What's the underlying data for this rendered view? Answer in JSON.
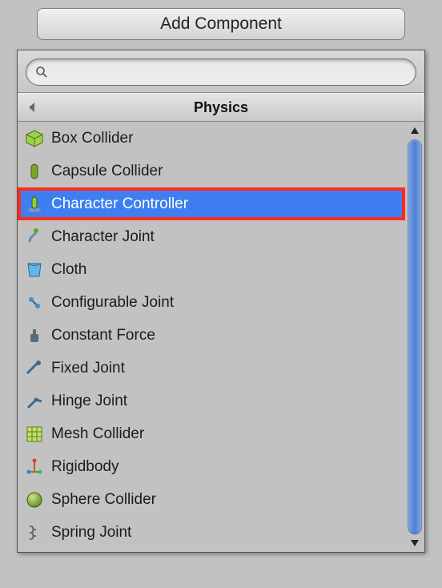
{
  "button": {
    "label": "Add Component"
  },
  "search": {
    "placeholder": "",
    "value": ""
  },
  "header": {
    "title": "Physics"
  },
  "selected_index": 2,
  "items": [
    {
      "label": "Box Collider",
      "icon": "box-collider-icon"
    },
    {
      "label": "Capsule Collider",
      "icon": "capsule-collider-icon"
    },
    {
      "label": "Character Controller",
      "icon": "character-controller-icon"
    },
    {
      "label": "Character Joint",
      "icon": "character-joint-icon"
    },
    {
      "label": "Cloth",
      "icon": "cloth-icon"
    },
    {
      "label": "Configurable Joint",
      "icon": "configurable-joint-icon"
    },
    {
      "label": "Constant Force",
      "icon": "constant-force-icon"
    },
    {
      "label": "Fixed Joint",
      "icon": "fixed-joint-icon"
    },
    {
      "label": "Hinge Joint",
      "icon": "hinge-joint-icon"
    },
    {
      "label": "Mesh Collider",
      "icon": "mesh-collider-icon"
    },
    {
      "label": "Rigidbody",
      "icon": "rigidbody-icon"
    },
    {
      "label": "Sphere Collider",
      "icon": "sphere-collider-icon"
    },
    {
      "label": "Spring Joint",
      "icon": "spring-joint-icon"
    }
  ],
  "icon_svg": {
    "box-collider-icon": "<svg width='24' height='24' viewBox='0 0 24 24'><polygon points='12,2 22,7 22,17 12,22 2,17 2,7' fill='#9fd24a' stroke='#4b6e16' stroke-width='1'/><polyline points='2,7 12,12 22,7' fill='none' stroke='#4b6e16' stroke-width='1'/><line x1='12' y1='12' x2='12' y2='22' stroke='#4b6e16' stroke-width='1'/></svg>",
    "capsule-collider-icon": "<svg width='24' height='24' viewBox='0 0 24 24'><rect x='8' y='3' width='8' height='18' rx='4' fill='#7aa52a' stroke='#3d5a12' stroke-width='1'/></svg>",
    "character-controller-icon": "<svg width='24' height='24' viewBox='0 0 24 24'><ellipse cx='12' cy='19' rx='8' ry='3' fill='#8aa0b5' opacity='0.7'/><rect x='9' y='3' width='6' height='14' rx='3' fill='#8fcf3c' stroke='#3d5a12' stroke-width='1'/></svg>",
    "character-joint-icon": "<svg width='24' height='24' viewBox='0 0 24 24'><path d='M6 18 C6 10, 14 10, 14 4' fill='none' stroke='#5b8fb9' stroke-width='3'/><circle cx='14' cy='4' r='3' fill='#6e9e2b'/></svg>",
    "cloth-icon": "<svg width='24' height='24' viewBox='0 0 24 24'><path d='M4 4 L20 4 L18 20 L6 20 Z' fill='#61b8e6' stroke='#2a6a94' stroke-width='1'/><path d='M4 4 Q12 9 20 4' fill='none' stroke='#2a6a94' stroke-width='1'/></svg>",
    "configurable-joint-icon": "<svg width='24' height='24' viewBox='0 0 24 24'><circle cx='8' cy='8' r='3' fill='#4a8bc2'/><circle cx='16' cy='16' r='3' fill='#4a8bc2'/><line x1='10' y1='10' x2='14' y2='14' stroke='#2b5a82' stroke-width='2'/></svg>",
    "constant-force-icon": "<svg width='24' height='24' viewBox='0 0 24 24'><rect x='7' y='10' width='10' height='10' rx='2' fill='#5a6b78'/><rect x='10' y='4' width='4' height='6' fill='#5a6b78'/></svg>",
    "fixed-joint-icon": "<svg width='24' height='24' viewBox='0 0 24 24'><line x1='3' y1='18' x2='15' y2='6' stroke='#3a6a93' stroke-width='3'/><circle cx='17' cy='5' r='3' fill='#3a6a93'/></svg>",
    "hinge-joint-icon": "<svg width='24' height='24' viewBox='0 0 24 24'><line x1='4' y1='20' x2='14' y2='10' stroke='#3a6a93' stroke-width='3'/><line x1='14' y1='10' x2='21' y2='12' stroke='#3a6a93' stroke-width='3'/><circle cx='14' cy='10' r='2.5' fill='#3a6a93'/></svg>",
    "mesh-collider-icon": "<svg width='24' height='24' viewBox='0 0 24 24'><rect x='3' y='3' width='18' height='18' fill='#bfe36a' stroke='#5e7a1f' stroke-width='1'/><line x1='3' y1='9' x2='21' y2='9' stroke='#5e7a1f'/><line x1='3' y1='15' x2='21' y2='15' stroke='#5e7a1f'/><line x1='9' y1='3' x2='9' y2='21' stroke='#5e7a1f'/><line x1='15' y1='3' x2='15' y2='21' stroke='#5e7a1f'/></svg>",
    "rigidbody-icon": "<svg width='24' height='24' viewBox='0 0 24 24'><line x1='12' y1='4' x2='12' y2='18' stroke='#a66b1f' stroke-width='2'/><line x1='5' y1='18' x2='19' y2='18' stroke='#a66b1f' stroke-width='2'/><circle cx='12' cy='4' r='2.5' fill='#e63b3b'/><circle cx='5' cy='18' r='2.5' fill='#3b7ee6'/><circle cx='19' cy='18' r='2.5' fill='#3bbf5e'/></svg>",
    "sphere-collider-icon": "<svg width='24' height='24' viewBox='0 0 24 24'><defs><radialGradient id='sg' cx='0.35' cy='0.3' r='0.75'><stop offset='0%' stop-color='#cfe88a'/><stop offset='100%' stop-color='#5d8d1c'/></radialGradient></defs><circle cx='12' cy='12' r='9' fill='url(#sg)' stroke='#3d5a12' stroke-width='1'/></svg>",
    "spring-joint-icon": "<svg width='24' height='24' viewBox='0 0 24 24'><path d='M6 4 C14 4 6 8 14 8 C6 8 14 12 6 12 C14 12 6 16 14 16 C6 16 14 20 6 20' fill='none' stroke='#5e6b74' stroke-width='2'/></svg>"
  }
}
